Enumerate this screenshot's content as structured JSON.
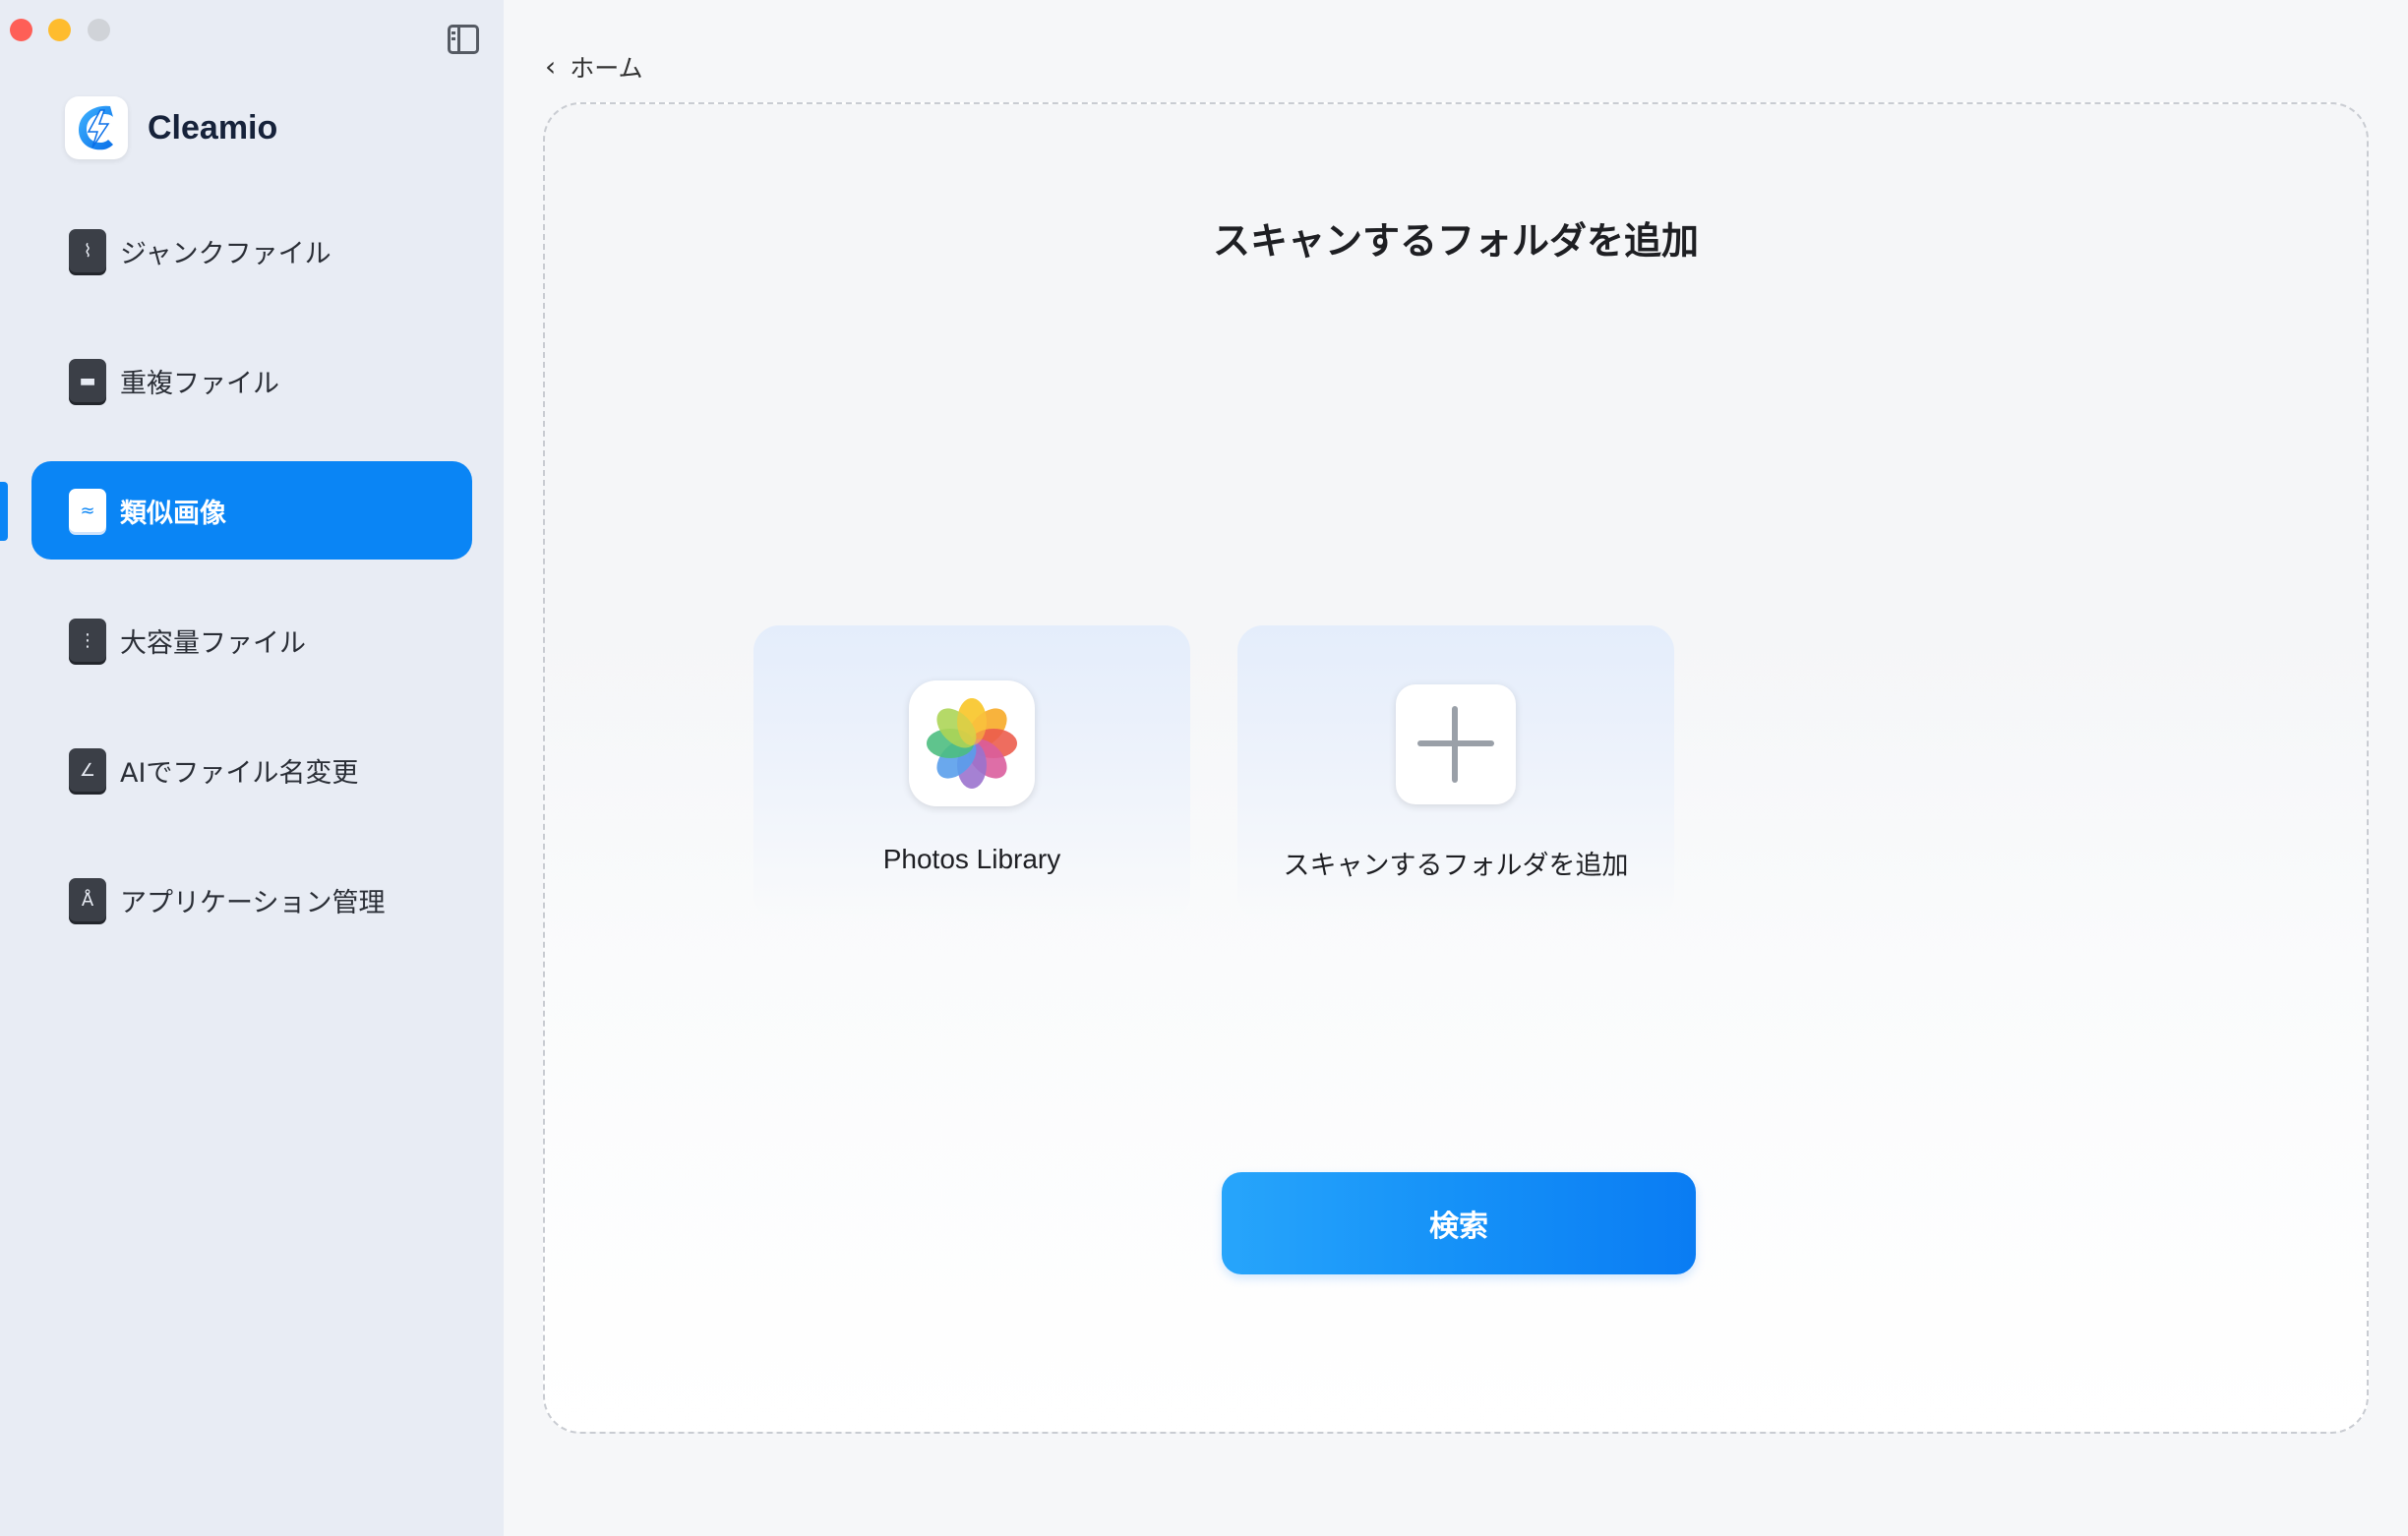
{
  "app": {
    "name": "Cleamio",
    "accent_color": "#0a85f5"
  },
  "sidebar": {
    "items": [
      {
        "label": "ジャンクファイル",
        "icon": "broom-icon",
        "active": false
      },
      {
        "label": "重複ファイル",
        "icon": "folder-icon",
        "active": false
      },
      {
        "label": "類似画像",
        "icon": "image-icon",
        "active": true
      },
      {
        "label": "大容量ファイル",
        "icon": "zip-file-icon",
        "active": false
      },
      {
        "label": "AIでファイル名変更",
        "icon": "file-rename-icon",
        "active": false
      },
      {
        "label": "アプリケーション管理",
        "icon": "app-store-icon",
        "active": false
      }
    ]
  },
  "header": {
    "back_label": "ホーム"
  },
  "main": {
    "title": "スキャンするフォルダを追加",
    "cards": [
      {
        "label": "Photos Library",
        "icon": "photos-app-icon"
      },
      {
        "label": "スキャンするフォルダを追加",
        "icon": "plus-icon"
      }
    ],
    "search_button_label": "検索"
  }
}
